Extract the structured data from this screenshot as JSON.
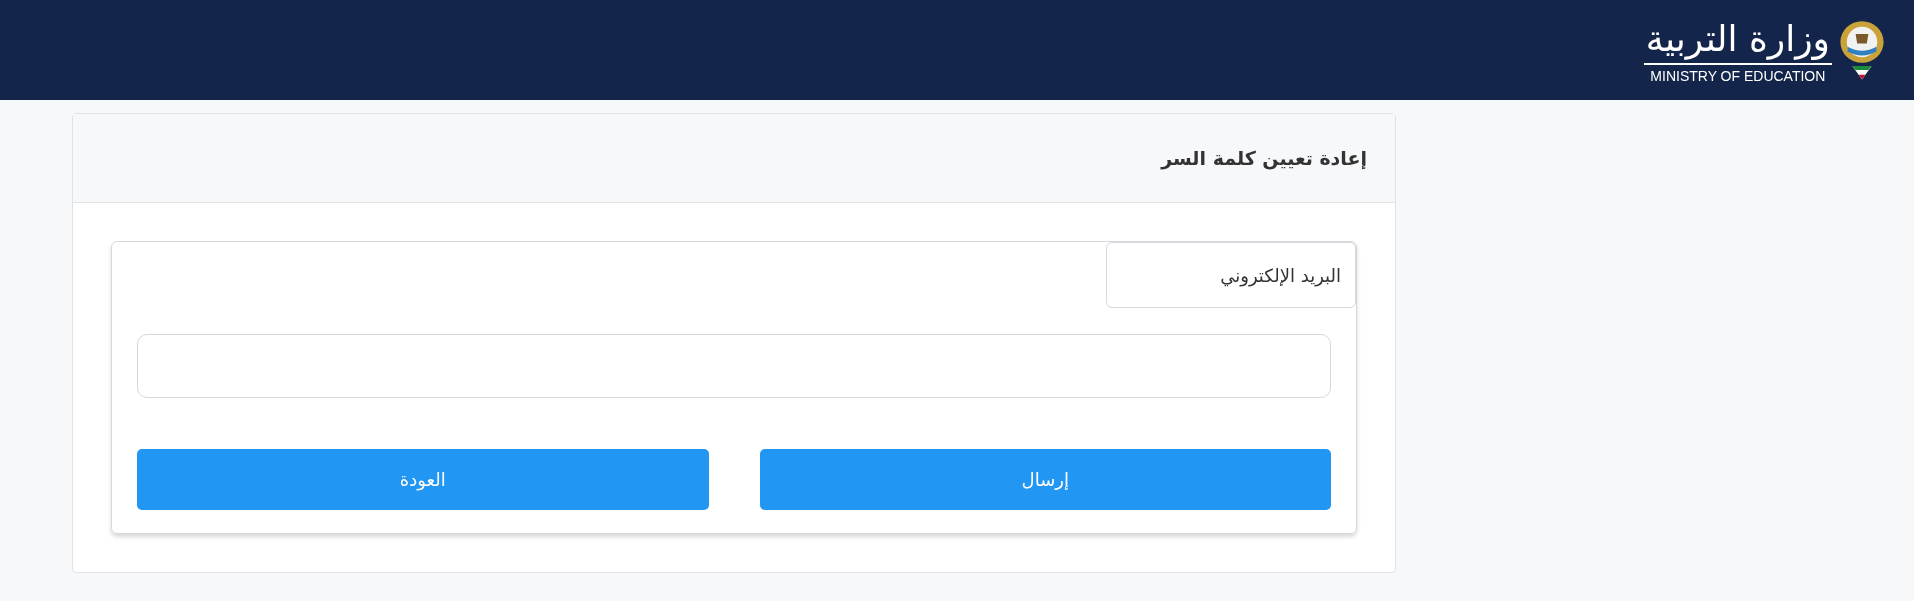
{
  "header": {
    "logo_arabic": "وزارة التربية",
    "logo_english": "MINISTRY OF EDUCATION"
  },
  "card": {
    "title": "إعادة تعيين كلمة السر"
  },
  "form": {
    "label": "البريد الإلكتروني",
    "buttons": [
      "إرسال",
      "العودة"
    ]
  }
}
